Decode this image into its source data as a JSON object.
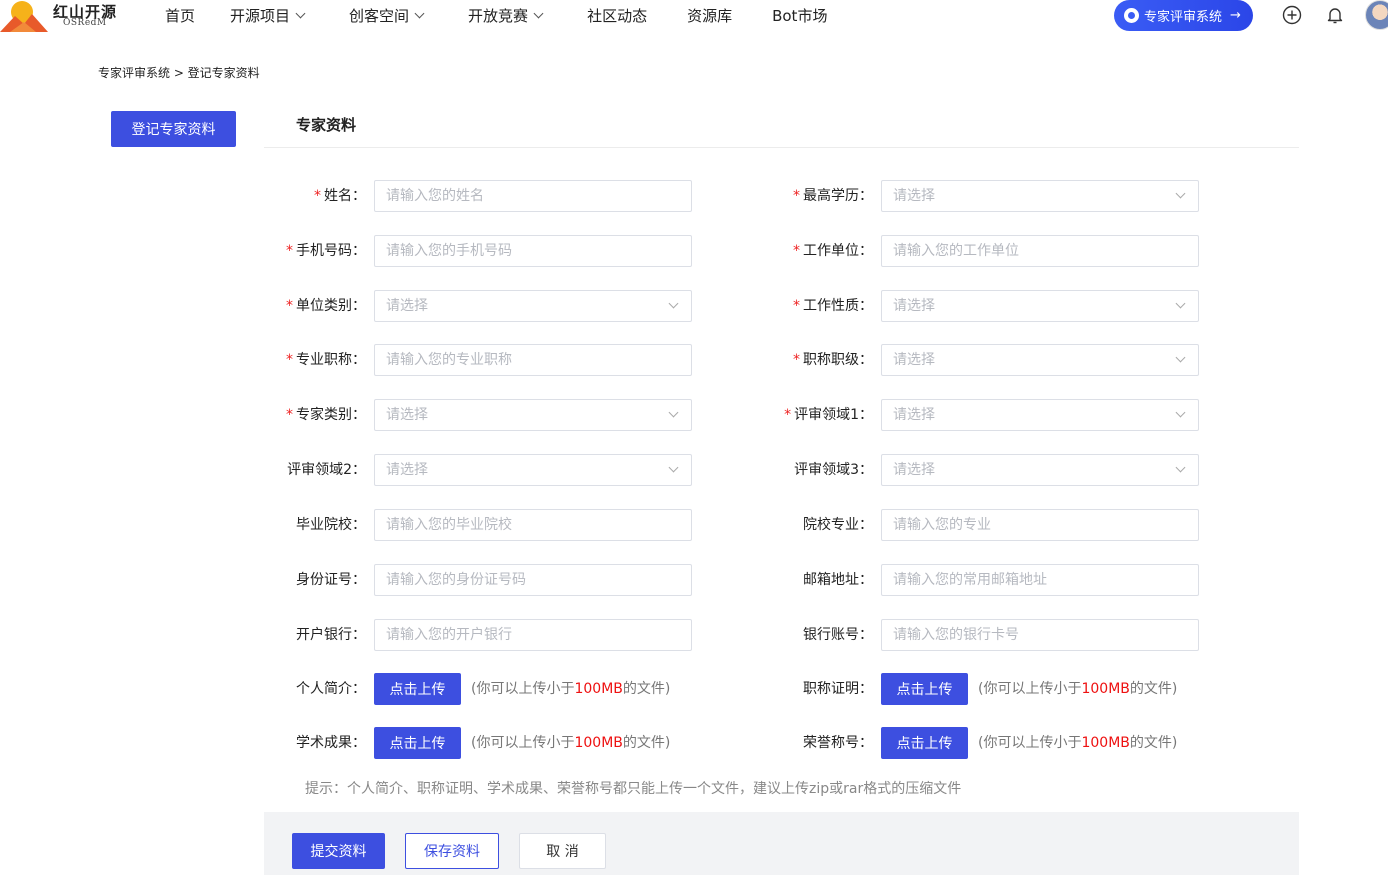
{
  "brand": {
    "name_cn": "红山开源",
    "name_en": "OSRedM"
  },
  "nav": {
    "items": [
      {
        "label": "首页",
        "dropdown": false
      },
      {
        "label": "开源项目",
        "dropdown": true
      },
      {
        "label": "创客空间",
        "dropdown": true
      },
      {
        "label": "开放竞赛",
        "dropdown": true
      },
      {
        "label": "社区动态",
        "dropdown": false
      },
      {
        "label": "资源库",
        "dropdown": false
      },
      {
        "label": "Bot市场",
        "dropdown": false
      }
    ],
    "expert_button": "专家评审系统",
    "icons": [
      "plus-circle-icon",
      "bell-icon",
      "avatar"
    ]
  },
  "breadcrumb": "专家评审系统 > 登记专家资料",
  "sidebar": {
    "active_item": "登记专家资料"
  },
  "panel": {
    "title": "专家资料"
  },
  "form": {
    "left": [
      {
        "label": "姓名",
        "required": true,
        "type": "input",
        "placeholder": "请输入您的姓名",
        "value": ""
      },
      {
        "label": "手机号码",
        "required": true,
        "type": "input",
        "placeholder": "请输入您的手机号码",
        "value": ""
      },
      {
        "label": "单位类别",
        "required": true,
        "type": "select",
        "placeholder": "请选择"
      },
      {
        "label": "专业职称",
        "required": true,
        "type": "input",
        "placeholder": "请输入您的专业职称",
        "value": ""
      },
      {
        "label": "专家类别",
        "required": true,
        "type": "select",
        "placeholder": "请选择"
      },
      {
        "label": "评审领域2",
        "required": false,
        "type": "select",
        "placeholder": "请选择"
      },
      {
        "label": "毕业院校",
        "required": false,
        "type": "input",
        "placeholder": "请输入您的毕业院校",
        "value": ""
      },
      {
        "label": "身份证号",
        "required": false,
        "type": "input",
        "placeholder": "请输入您的身份证号码",
        "value": ""
      },
      {
        "label": "开户银行",
        "required": false,
        "type": "input",
        "placeholder": "请输入您的开户银行",
        "value": ""
      }
    ],
    "right": [
      {
        "label": "最高学历",
        "required": true,
        "type": "select",
        "placeholder": "请选择"
      },
      {
        "label": "工作单位",
        "required": true,
        "type": "input",
        "placeholder": "请输入您的工作单位",
        "value": ""
      },
      {
        "label": "工作性质",
        "required": true,
        "type": "select",
        "placeholder": "请选择"
      },
      {
        "label": "职称职级",
        "required": true,
        "type": "select",
        "placeholder": "请选择"
      },
      {
        "label": "评审领域1",
        "required": true,
        "type": "select",
        "placeholder": "请选择"
      },
      {
        "label": "评审领域3",
        "required": false,
        "type": "select",
        "placeholder": "请选择"
      },
      {
        "label": "院校专业",
        "required": false,
        "type": "input",
        "placeholder": "请输入您的专业",
        "value": ""
      },
      {
        "label": "邮箱地址",
        "required": false,
        "type": "input",
        "placeholder": "请输入您的常用邮箱地址",
        "value": ""
      },
      {
        "label": "银行账号",
        "required": false,
        "type": "input",
        "placeholder": "请输入您的银行卡号",
        "value": ""
      }
    ],
    "uploads": {
      "left": [
        {
          "label": "个人简介"
        },
        {
          "label": "学术成果"
        }
      ],
      "right": [
        {
          "label": "职称证明"
        },
        {
          "label": "荣誉称号"
        }
      ],
      "button_label": "点击上传",
      "note_prefix": "(你可以上传小于",
      "note_limit": "100MB",
      "note_suffix": "的文件)"
    },
    "tip": "提示：个人简介、职称证明、学术成果、荣誉称号都只能上传一个文件，建议上传zip或rar格式的压缩文件"
  },
  "actions": {
    "submit": "提交资料",
    "save": "保存资料",
    "cancel": "取 消"
  },
  "colors": {
    "primary": "#3d4fe0",
    "required": "#e22222",
    "highlight": "#e11111"
  }
}
